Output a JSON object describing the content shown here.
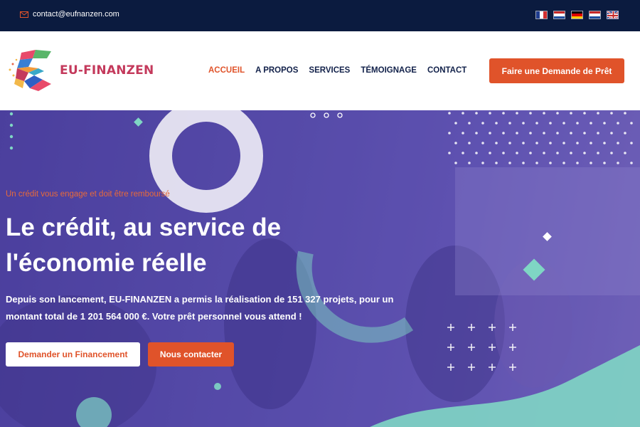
{
  "topbar": {
    "email": "contact@eufnanzen.com",
    "languages": [
      "fr",
      "nl",
      "de",
      "nl",
      "en"
    ]
  },
  "header": {
    "brand": "EU-FINANZEN",
    "nav": [
      "ACCUEIL",
      "A PROPOS",
      "SERVICES",
      "TÉMOIGNAGE",
      "CONTACT"
    ],
    "active_nav": "ACCUEIL",
    "cta_label": "Faire une Demande de Prêt"
  },
  "hero": {
    "tagline": "Un crédit vous engage et doit être remboursé",
    "headline": "Le crédit, au service de l'économie réelle",
    "description": "Depuis son lancement, EU-FINANZEN a permis la réalisation de 151 327 projets, pour un montant total de 1 201 564 000 €. Votre prêt personnel vous attend !",
    "primary_button": "Demander un Financement",
    "secondary_button": "Nous contacter"
  },
  "colors": {
    "topbar": "#0b1b3f",
    "accent": "#e0532a",
    "brand": "#c43a5c",
    "hero": "#5a4fae",
    "teal": "#7fd6c4"
  },
  "icons": {
    "email": "envelope-icon",
    "logo": "eu-finanzen-logo-icon",
    "plus_pattern": "plus-icon"
  }
}
